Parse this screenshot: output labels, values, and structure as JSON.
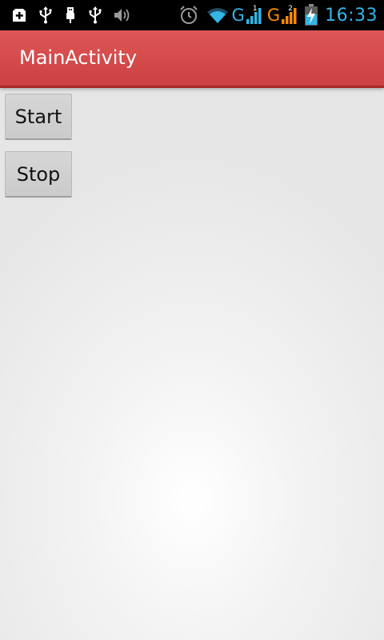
{
  "status_bar": {
    "time": "16:33",
    "network_type_1": "G",
    "network_type_2": "G",
    "sim_1": "1",
    "sim_2": "2",
    "left_icons": [
      "add-notification-icon",
      "usb-icon",
      "usb-debug-icon",
      "usb-icon",
      "volume-icon"
    ],
    "right_icons": [
      "alarm-icon",
      "wifi-icon",
      "signal-sim1-icon",
      "signal-sim2-icon",
      "battery-charging-icon"
    ],
    "colors": {
      "time": "#33b5e5",
      "sim1_network": "#33b5e5",
      "sim2_network": "#ff8a00"
    }
  },
  "action_bar": {
    "title": "MainActivity",
    "color": "#d64b4b"
  },
  "buttons": {
    "start_label": "Start",
    "stop_label": "Stop"
  }
}
